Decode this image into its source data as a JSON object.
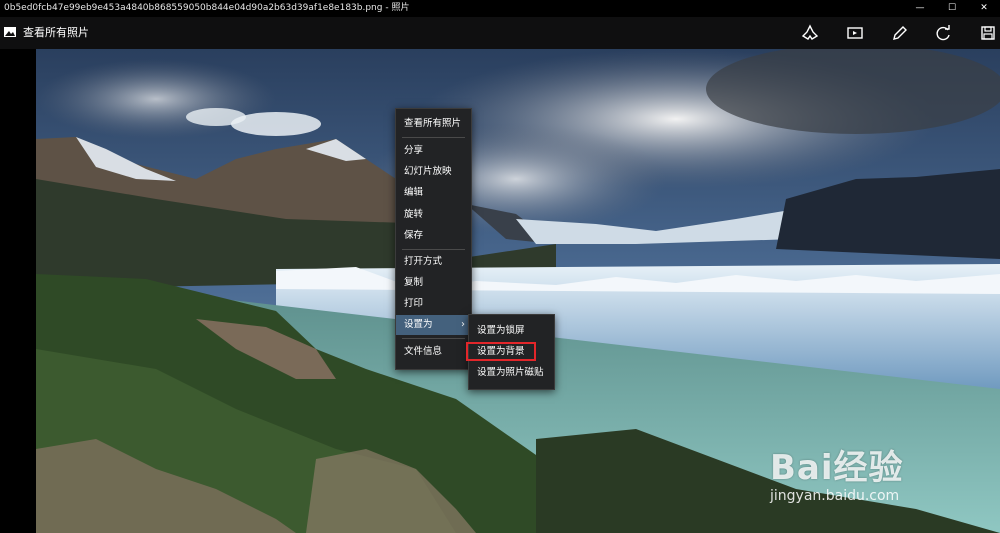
{
  "window": {
    "title": "0b5ed0fcb47e99eb9e453a4840b868559050b844e04d90a2b63d39af1e8e183b.png - 照片",
    "minimize": "—",
    "maximize": "☐",
    "close": "✕"
  },
  "appbar": {
    "back_label": "查看所有照片",
    "tools": [
      "enhance-icon",
      "slideshow-icon",
      "edit-icon",
      "rotate-icon",
      "save-icon"
    ]
  },
  "context_menu": {
    "items": [
      {
        "label": "查看所有照片"
      },
      {
        "label": "分享"
      },
      {
        "label": "幻灯片放映"
      },
      {
        "label": "编辑"
      },
      {
        "label": "旋转"
      },
      {
        "label": "保存"
      },
      {
        "label": "打开方式"
      },
      {
        "label": "复制"
      },
      {
        "label": "打印"
      },
      {
        "label": "设置为",
        "has_submenu": true,
        "chevron": "›"
      },
      {
        "label": "文件信息"
      }
    ]
  },
  "submenu": {
    "items": [
      {
        "label": "设置为锁屏"
      },
      {
        "label": "设置为背景"
      },
      {
        "label": "设置为照片磁贴"
      }
    ],
    "highlighted": "设置为背景",
    "highlight_color": "#e3262a"
  },
  "watermark": {
    "logo": "Bai经验",
    "url": "jingyan.baidu.com"
  },
  "colors": {
    "menu_bg": "#222325",
    "menu_active": "#44617d"
  }
}
